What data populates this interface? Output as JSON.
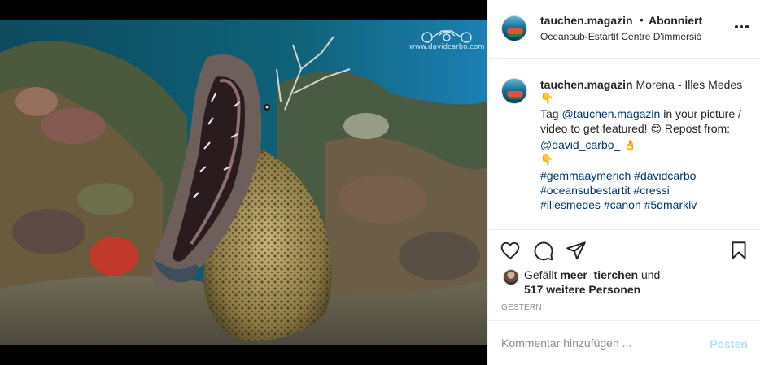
{
  "header": {
    "username": "tauchen.magazin",
    "separator": "•",
    "follow_status": "Abonniert",
    "location": "Oceansub-Estartit Centre D'immersió",
    "more_icon": "more-horizontal-icon"
  },
  "media": {
    "watermark": "www.davidcarbo.com"
  },
  "caption": {
    "username": "tauchen.magazin",
    "title": "Morena - Illes Medes",
    "emoji_point": "👇",
    "tag_prefix": "Tag",
    "tag_link": "@tauchen.magazin",
    "tag_rest": "in your picture / video to get featured!",
    "emoji_love": "😍",
    "repost_prefix": "Repost from:",
    "repost_link": "@david_carbo_",
    "emoji_ok": "👌",
    "emoji_point2": "👇",
    "hashtags_1": "#gemmaaymerich #davidcarbo",
    "hashtags_2": "#oceansubestartit #cressi",
    "hashtags_3": "#illesmedes #canon #5dmarkiv"
  },
  "actions": {
    "like_icon": "heart-icon",
    "comment_icon": "comment-bubble-icon",
    "share_icon": "paper-plane-icon",
    "save_icon": "bookmark-icon"
  },
  "likes": {
    "prefix": "Gefällt",
    "user": "meer_tierchen",
    "conj": "und",
    "others": "517 weitere Personen"
  },
  "date": "GESTERN",
  "comment": {
    "placeholder": "Kommentar hinzufügen ...",
    "post_label": "Posten"
  },
  "colors": {
    "link": "#00376b",
    "post_disabled": "#b2dffc",
    "muted": "#8e8e8e",
    "border": "#efefef"
  }
}
